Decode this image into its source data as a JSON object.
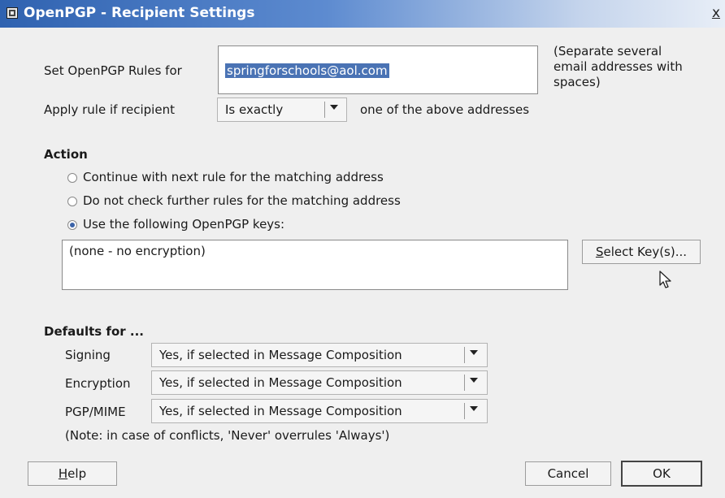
{
  "window": {
    "title": "OpenPGP - Recipient Settings",
    "close_label": "x"
  },
  "rules": {
    "label": "Set OpenPGP Rules for",
    "email_value": "springforschools@aol.com",
    "hint": "(Separate several email addresses with spaces)",
    "hint_line1": "(Separate several",
    "hint_line2": "email addresses with",
    "hint_line3": "spaces)"
  },
  "apply": {
    "label": "Apply rule if recipient",
    "selected": "Is exactly",
    "suffix": "one of the above addresses"
  },
  "action": {
    "heading": "Action",
    "options": [
      {
        "label": "Continue with next rule for the matching address",
        "selected": false
      },
      {
        "label": "Do not check further rules for the matching address",
        "selected": false
      },
      {
        "label": "Use the following OpenPGP keys:",
        "selected": true
      }
    ],
    "keys_value": "(none - no encryption)",
    "select_keys_button": "Select Key(s)...",
    "select_keys_mnemonic": "S",
    "select_keys_rest": "elect Key(s)..."
  },
  "defaults": {
    "heading": "Defaults for ...",
    "rows": [
      {
        "label": "Signing",
        "value": "Yes, if selected in Message Composition"
      },
      {
        "label": "Encryption",
        "value": "Yes, if selected in Message Composition"
      },
      {
        "label": "PGP/MIME",
        "value": "Yes, if selected in Message Composition"
      }
    ],
    "note": "(Note: in case of conflicts, 'Never' overrules 'Always')"
  },
  "buttons": {
    "help_mnemonic": "H",
    "help_rest": "elp",
    "cancel": "Cancel",
    "ok": "OK"
  },
  "colors": {
    "title_gradient_start": "#2f62b0",
    "selection": "#4a73b4",
    "radio_dot": "#3b63a8"
  }
}
